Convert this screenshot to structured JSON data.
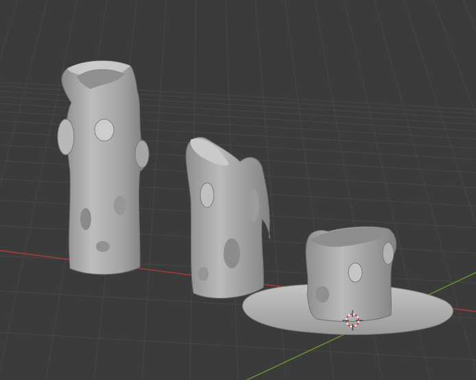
{
  "viewport": {
    "background": "#3b3b3b",
    "grid_line_color": "#474747",
    "x_axis_color": "#b03a3a",
    "y_axis_color": "#6c9a2a",
    "object_color": "#a9a9a9"
  },
  "scene": {
    "objects": [
      {
        "name": "tall-candle-object",
        "type": "sculpted-mesh"
      },
      {
        "name": "medium-candle-object",
        "type": "sculpted-mesh"
      },
      {
        "name": "short-candle-with-dish-object",
        "type": "sculpted-mesh"
      }
    ],
    "cursor_icon": "3d-cursor-icon"
  }
}
